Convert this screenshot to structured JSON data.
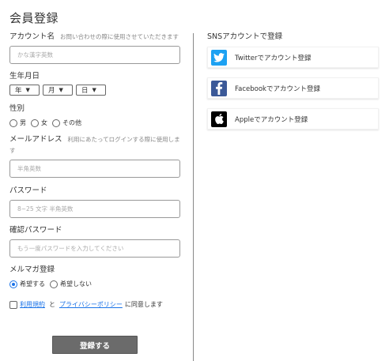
{
  "page": {
    "title": "会員登録"
  },
  "form": {
    "name": {
      "label": "アカウント名",
      "hint": "お問い合わせの際に使用させていただきます",
      "placeholder": "かな漢字英数"
    },
    "birthday": {
      "label": "生年月日",
      "year": "年",
      "month": "月",
      "day": "日"
    },
    "gender": {
      "label": "性別",
      "options": [
        "男",
        "女",
        "その他"
      ]
    },
    "email": {
      "label": "メールアドレス",
      "hint": "利用にあたってログインする際に使用します",
      "placeholder": "半角英数"
    },
    "password": {
      "label": "パスワード",
      "placeholder": "8~25 文字 半角英数"
    },
    "confirm": {
      "label": "確認パスワード",
      "placeholder": "もう一度パスワードを入力してください"
    },
    "newsletter": {
      "label": "メルマガ登録",
      "options": [
        "希望する",
        "希望しない"
      ],
      "selected": "希望する"
    },
    "terms": {
      "link1": "利用規約",
      "and": "と",
      "link2": "プライバシーポリシー",
      "suffix": "に同意します"
    },
    "submit_label": "登録する"
  },
  "sns": {
    "title": "SNSアカウントで登録",
    "buttons": [
      {
        "label": "Twitterでアカウント登録",
        "icon": "twitter-icon",
        "color": "#1da1f2"
      },
      {
        "label": "Facebookでアカウント登録",
        "icon": "facebook-icon",
        "color": "#3b5998"
      },
      {
        "label": "Appleでアカウント登録",
        "icon": "apple-icon",
        "color": "#000000"
      }
    ]
  }
}
